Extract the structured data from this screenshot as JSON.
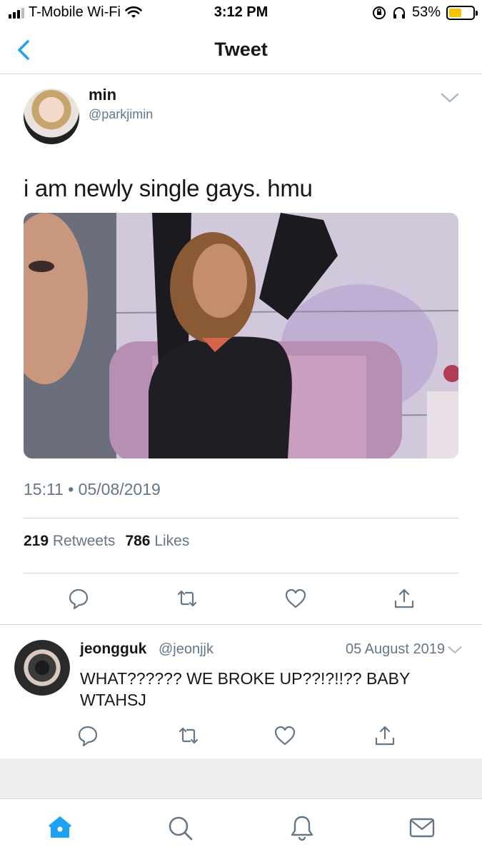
{
  "status_bar": {
    "carrier": "T-Mobile Wi-Fi",
    "time": "3:12 PM",
    "battery_percent": "53%",
    "battery_level": 0.53
  },
  "nav": {
    "title": "Tweet",
    "back_icon": "chevron-left-icon"
  },
  "tweet": {
    "author_name": "min",
    "author_handle": "@parkjimin",
    "text": "i am newly single gays. hmu",
    "timestamp": "15:11 • 05/08/2019",
    "retweets_count": "219",
    "retweets_label": "Retweets",
    "likes_count": "786",
    "likes_label": "Likes",
    "actions": [
      "reply-icon",
      "retweet-icon",
      "like-icon",
      "share-icon"
    ]
  },
  "reply": {
    "author_name": "jeongguk",
    "author_handle": "@jeonjjk",
    "date": "05 August 2019",
    "text": "WHAT?????? WE BROKE UP??!?!!?? BABY WTAHSJ",
    "actions": [
      "reply-icon",
      "retweet-icon",
      "like-icon",
      "share-icon"
    ]
  },
  "tab_bar": {
    "tabs": [
      "home-icon",
      "search-icon",
      "notifications-icon",
      "messages-icon"
    ],
    "active_tab": "home-icon"
  },
  "colors": {
    "accent": "#1da1f2",
    "secondary_text": "#657786",
    "battery": "#f5c400"
  }
}
